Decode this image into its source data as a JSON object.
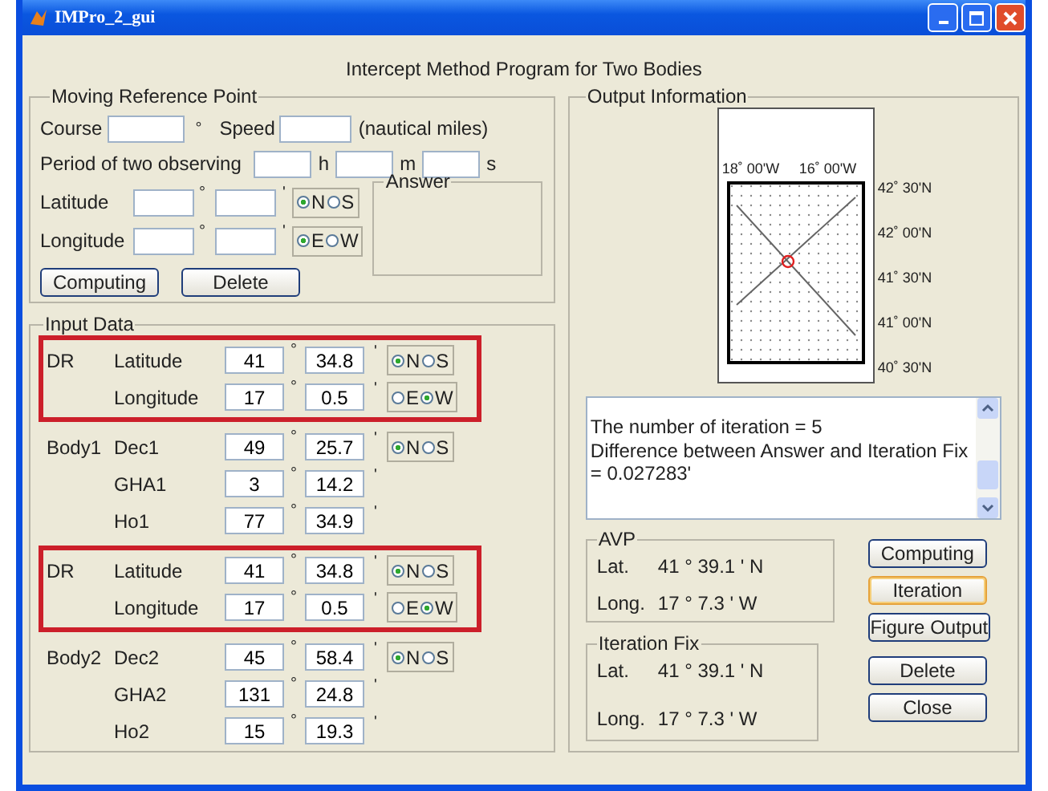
{
  "window": {
    "title": "IMPro_2_gui"
  },
  "heading": "Intercept Method Program for Two Bodies",
  "moving_reference_point": {
    "title": "Moving Reference Point",
    "course_label": "Course",
    "course_unit": "°",
    "speed_label": "Speed",
    "speed_unit": "(nautical miles)",
    "period_label": "Period of two observing",
    "period_units": [
      "h",
      "m",
      "s"
    ],
    "latitude": {
      "label": "Latitude",
      "deg_mark": "°",
      "min_mark": "'",
      "hemisphere": [
        {
          "label": "N",
          "selected": true
        },
        {
          "label": "S",
          "selected": false
        }
      ]
    },
    "longitude": {
      "label": "Longitude",
      "deg_mark": "°",
      "min_mark": "'",
      "hemisphere": [
        {
          "label": "E",
          "selected": true
        },
        {
          "label": "W",
          "selected": false
        }
      ]
    },
    "answer_title": "Answer",
    "buttons": [
      "Computing",
      "Delete"
    ]
  },
  "input_data": {
    "title": "Input Data",
    "groups": [
      {
        "name": "DR",
        "highlighted": true,
        "rows": [
          {
            "label": "Latitude",
            "deg": "41",
            "min": "34.8",
            "deg_mark": "°",
            "min_mark": "'",
            "hemisphere": [
              {
                "label": "N",
                "selected": true
              },
              {
                "label": "S",
                "selected": false
              }
            ]
          },
          {
            "label": "Longitude",
            "deg": "17",
            "min": "0.5",
            "deg_mark": "°",
            "min_mark": "'",
            "hemisphere": [
              {
                "label": "E",
                "selected": false
              },
              {
                "label": "W",
                "selected": true
              }
            ]
          }
        ]
      },
      {
        "name": "Body1",
        "highlighted": false,
        "rows": [
          {
            "label": "Dec1",
            "deg": "49",
            "min": "25.7",
            "deg_mark": "°",
            "min_mark": "'",
            "hemisphere": [
              {
                "label": "N",
                "selected": true
              },
              {
                "label": "S",
                "selected": false
              }
            ]
          },
          {
            "label": "GHA1",
            "deg": "3",
            "min": "14.2",
            "deg_mark": "°",
            "min_mark": "'"
          },
          {
            "label": "Ho1",
            "deg": "77",
            "min": "34.9",
            "deg_mark": "°",
            "min_mark": "'"
          }
        ]
      },
      {
        "name": "DR",
        "highlighted": true,
        "rows": [
          {
            "label": "Latitude",
            "deg": "41",
            "min": "34.8",
            "deg_mark": "°",
            "min_mark": "'",
            "hemisphere": [
              {
                "label": "N",
                "selected": true
              },
              {
                "label": "S",
                "selected": false
              }
            ]
          },
          {
            "label": "Longitude",
            "deg": "17",
            "min": "0.5",
            "deg_mark": "°",
            "min_mark": "'",
            "hemisphere": [
              {
                "label": "E",
                "selected": false
              },
              {
                "label": "W",
                "selected": true
              }
            ]
          }
        ]
      },
      {
        "name": "Body2",
        "highlighted": false,
        "rows": [
          {
            "label": "Dec2",
            "deg": "45",
            "min": "58.4",
            "deg_mark": "°",
            "min_mark": "'",
            "hemisphere": [
              {
                "label": "N",
                "selected": true
              },
              {
                "label": "S",
                "selected": false
              }
            ]
          },
          {
            "label": "GHA2",
            "deg": "131",
            "min": "24.8",
            "deg_mark": "°",
            "min_mark": "'"
          },
          {
            "label": "Ho2",
            "deg": "15",
            "min": "19.3",
            "deg_mark": "°",
            "min_mark": "'"
          }
        ]
      }
    ]
  },
  "output": {
    "title": "Output Information",
    "plot": {
      "lon_labels": [
        "18˚ 00'W",
        "16˚ 00'W"
      ],
      "lat_labels": [
        "42˚ 30'N",
        "42˚ 00'N",
        "41˚ 30'N",
        "41˚ 00'N",
        "40˚ 30'N"
      ]
    },
    "log_lines": [
      "The number of iteration = 5",
      "Difference between Answer and Iteration Fix",
      "= 0.027283'"
    ],
    "avp": {
      "title": "AVP",
      "lat_label": "Lat.",
      "lat": "41 ° 39.1 ' N",
      "long_label": "Long.",
      "long": "17 ° 7.3 ' W"
    },
    "iteration_fix": {
      "title": "Iteration Fix",
      "lat_label": "Lat.",
      "lat": "41 ° 39.1 ' N",
      "long_label": "Long.",
      "long": "17 ° 7.3 ' W"
    },
    "buttons": [
      {
        "label": "Computing",
        "focused": false
      },
      {
        "label": "Iteration",
        "focused": true
      },
      {
        "label": "Figure Output",
        "focused": false
      },
      {
        "label": "Delete",
        "focused": false
      },
      {
        "label": "Close",
        "focused": false
      }
    ]
  }
}
